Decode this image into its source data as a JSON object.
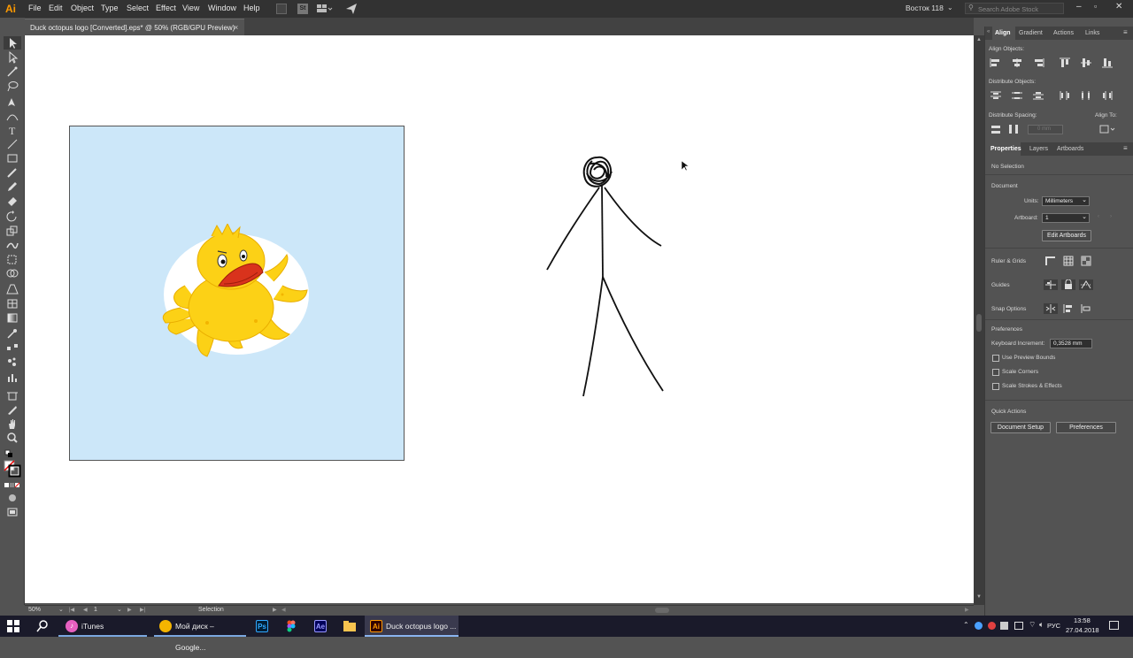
{
  "app": {
    "logo": "Ai"
  },
  "menu": [
    "File",
    "Edit",
    "Object",
    "Type",
    "Select",
    "Effect",
    "View",
    "Window",
    "Help"
  ],
  "workspace": {
    "label": "Восток 118",
    "search_placeholder": "Search Adobe Stock"
  },
  "document": {
    "tab_label": "Duck octopus logo [Converted].eps* @ 50% (RGB/GPU Preview)",
    "close_glyph": "×"
  },
  "status": {
    "zoom": "50%",
    "artboard_nav": "1",
    "tool": "Selection"
  },
  "align_panel": {
    "tabs": [
      "Align",
      "Gradient",
      "Actions",
      "Links"
    ],
    "align_objects": "Align Objects:",
    "distribute_objects": "Distribute Objects:",
    "distribute_spacing": "Distribute Spacing:",
    "align_to": "Align To:",
    "spacing_value": "0 mm"
  },
  "properties_panel": {
    "tabs": [
      "Properties",
      "Layers",
      "Artboards"
    ],
    "selection": "No Selection",
    "document_heading": "Document",
    "units_label": "Units:",
    "units_value": "Millimeters",
    "artboard_label": "Artboard:",
    "artboard_value": "1",
    "edit_artboards": "Edit Artboards",
    "ruler_grids": "Ruler & Grids",
    "guides": "Guides",
    "snap_options": "Snap Options",
    "preferences_heading": "Preferences",
    "keyboard_increment_label": "Keyboard Increment:",
    "keyboard_increment_value": "0,3528 mm",
    "checkboxes": [
      "Use Preview Bounds",
      "Scale Corners",
      "Scale Strokes & Effects"
    ],
    "quick_actions": "Quick Actions",
    "document_setup": "Document Setup",
    "preferences_button": "Preferences"
  },
  "taskbar": {
    "items": [
      "iTunes",
      "Мой диск – Google...",
      "Duck octopus logo ..."
    ],
    "lang": "РУС",
    "time": "13:58",
    "date": "27.04.2018"
  },
  "colors": {
    "accent_ai": "#ff9a00",
    "artboard_bg": "#cce7f9",
    "duck_yellow": "#fcd116",
    "beak_red": "#d9331c"
  }
}
